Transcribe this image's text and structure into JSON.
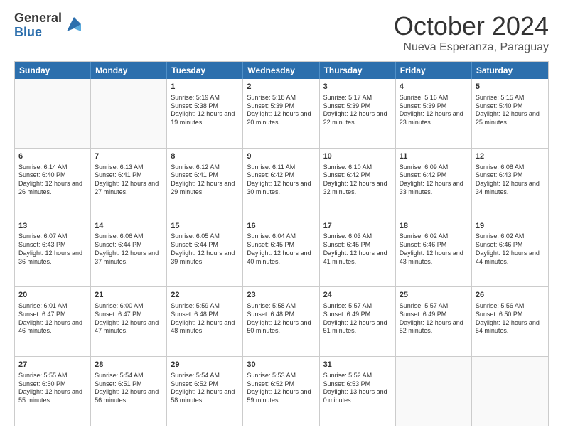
{
  "logo": {
    "general": "General",
    "blue": "Blue"
  },
  "header": {
    "month": "October 2024",
    "location": "Nueva Esperanza, Paraguay"
  },
  "days": [
    "Sunday",
    "Monday",
    "Tuesday",
    "Wednesday",
    "Thursday",
    "Friday",
    "Saturday"
  ],
  "weeks": [
    [
      {
        "day": "",
        "empty": true
      },
      {
        "day": "",
        "empty": true
      },
      {
        "day": "1",
        "sunrise": "Sunrise: 5:19 AM",
        "sunset": "Sunset: 5:38 PM",
        "daylight": "Daylight: 12 hours and 19 minutes."
      },
      {
        "day": "2",
        "sunrise": "Sunrise: 5:18 AM",
        "sunset": "Sunset: 5:39 PM",
        "daylight": "Daylight: 12 hours and 20 minutes."
      },
      {
        "day": "3",
        "sunrise": "Sunrise: 5:17 AM",
        "sunset": "Sunset: 5:39 PM",
        "daylight": "Daylight: 12 hours and 22 minutes."
      },
      {
        "day": "4",
        "sunrise": "Sunrise: 5:16 AM",
        "sunset": "Sunset: 5:39 PM",
        "daylight": "Daylight: 12 hours and 23 minutes."
      },
      {
        "day": "5",
        "sunrise": "Sunrise: 5:15 AM",
        "sunset": "Sunset: 5:40 PM",
        "daylight": "Daylight: 12 hours and 25 minutes."
      }
    ],
    [
      {
        "day": "6",
        "sunrise": "Sunrise: 6:14 AM",
        "sunset": "Sunset: 6:40 PM",
        "daylight": "Daylight: 12 hours and 26 minutes."
      },
      {
        "day": "7",
        "sunrise": "Sunrise: 6:13 AM",
        "sunset": "Sunset: 6:41 PM",
        "daylight": "Daylight: 12 hours and 27 minutes."
      },
      {
        "day": "8",
        "sunrise": "Sunrise: 6:12 AM",
        "sunset": "Sunset: 6:41 PM",
        "daylight": "Daylight: 12 hours and 29 minutes."
      },
      {
        "day": "9",
        "sunrise": "Sunrise: 6:11 AM",
        "sunset": "Sunset: 6:42 PM",
        "daylight": "Daylight: 12 hours and 30 minutes."
      },
      {
        "day": "10",
        "sunrise": "Sunrise: 6:10 AM",
        "sunset": "Sunset: 6:42 PM",
        "daylight": "Daylight: 12 hours and 32 minutes."
      },
      {
        "day": "11",
        "sunrise": "Sunrise: 6:09 AM",
        "sunset": "Sunset: 6:42 PM",
        "daylight": "Daylight: 12 hours and 33 minutes."
      },
      {
        "day": "12",
        "sunrise": "Sunrise: 6:08 AM",
        "sunset": "Sunset: 6:43 PM",
        "daylight": "Daylight: 12 hours and 34 minutes."
      }
    ],
    [
      {
        "day": "13",
        "sunrise": "Sunrise: 6:07 AM",
        "sunset": "Sunset: 6:43 PM",
        "daylight": "Daylight: 12 hours and 36 minutes."
      },
      {
        "day": "14",
        "sunrise": "Sunrise: 6:06 AM",
        "sunset": "Sunset: 6:44 PM",
        "daylight": "Daylight: 12 hours and 37 minutes."
      },
      {
        "day": "15",
        "sunrise": "Sunrise: 6:05 AM",
        "sunset": "Sunset: 6:44 PM",
        "daylight": "Daylight: 12 hours and 39 minutes."
      },
      {
        "day": "16",
        "sunrise": "Sunrise: 6:04 AM",
        "sunset": "Sunset: 6:45 PM",
        "daylight": "Daylight: 12 hours and 40 minutes."
      },
      {
        "day": "17",
        "sunrise": "Sunrise: 6:03 AM",
        "sunset": "Sunset: 6:45 PM",
        "daylight": "Daylight: 12 hours and 41 minutes."
      },
      {
        "day": "18",
        "sunrise": "Sunrise: 6:02 AM",
        "sunset": "Sunset: 6:46 PM",
        "daylight": "Daylight: 12 hours and 43 minutes."
      },
      {
        "day": "19",
        "sunrise": "Sunrise: 6:02 AM",
        "sunset": "Sunset: 6:46 PM",
        "daylight": "Daylight: 12 hours and 44 minutes."
      }
    ],
    [
      {
        "day": "20",
        "sunrise": "Sunrise: 6:01 AM",
        "sunset": "Sunset: 6:47 PM",
        "daylight": "Daylight: 12 hours and 46 minutes."
      },
      {
        "day": "21",
        "sunrise": "Sunrise: 6:00 AM",
        "sunset": "Sunset: 6:47 PM",
        "daylight": "Daylight: 12 hours and 47 minutes."
      },
      {
        "day": "22",
        "sunrise": "Sunrise: 5:59 AM",
        "sunset": "Sunset: 6:48 PM",
        "daylight": "Daylight: 12 hours and 48 minutes."
      },
      {
        "day": "23",
        "sunrise": "Sunrise: 5:58 AM",
        "sunset": "Sunset: 6:48 PM",
        "daylight": "Daylight: 12 hours and 50 minutes."
      },
      {
        "day": "24",
        "sunrise": "Sunrise: 5:57 AM",
        "sunset": "Sunset: 6:49 PM",
        "daylight": "Daylight: 12 hours and 51 minutes."
      },
      {
        "day": "25",
        "sunrise": "Sunrise: 5:57 AM",
        "sunset": "Sunset: 6:49 PM",
        "daylight": "Daylight: 12 hours and 52 minutes."
      },
      {
        "day": "26",
        "sunrise": "Sunrise: 5:56 AM",
        "sunset": "Sunset: 6:50 PM",
        "daylight": "Daylight: 12 hours and 54 minutes."
      }
    ],
    [
      {
        "day": "27",
        "sunrise": "Sunrise: 5:55 AM",
        "sunset": "Sunset: 6:50 PM",
        "daylight": "Daylight: 12 hours and 55 minutes."
      },
      {
        "day": "28",
        "sunrise": "Sunrise: 5:54 AM",
        "sunset": "Sunset: 6:51 PM",
        "daylight": "Daylight: 12 hours and 56 minutes."
      },
      {
        "day": "29",
        "sunrise": "Sunrise: 5:54 AM",
        "sunset": "Sunset: 6:52 PM",
        "daylight": "Daylight: 12 hours and 58 minutes."
      },
      {
        "day": "30",
        "sunrise": "Sunrise: 5:53 AM",
        "sunset": "Sunset: 6:52 PM",
        "daylight": "Daylight: 12 hours and 59 minutes."
      },
      {
        "day": "31",
        "sunrise": "Sunrise: 5:52 AM",
        "sunset": "Sunset: 6:53 PM",
        "daylight": "Daylight: 13 hours and 0 minutes."
      },
      {
        "day": "",
        "empty": true
      },
      {
        "day": "",
        "empty": true
      }
    ]
  ]
}
